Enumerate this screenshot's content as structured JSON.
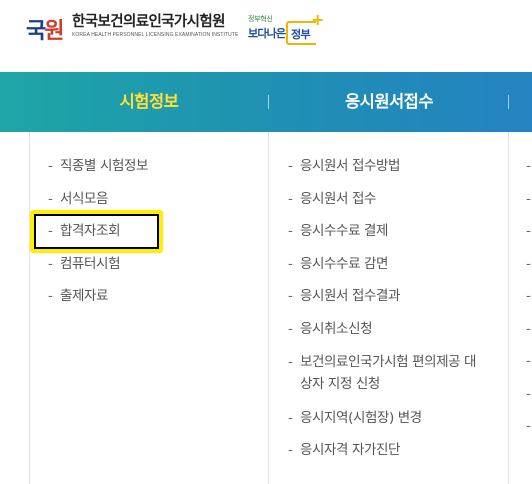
{
  "header": {
    "logo_mark_1": "국",
    "logo_mark_2": "원",
    "org_name_kor": "한국보건의료인국가시험원",
    "org_name_eng": "KOREA HEALTH PERSONNEL LICENSING EXAMINATION INSTITUTE",
    "gov_top": "정부혁신",
    "gov_main": "보다나은",
    "gov_badge": "정부"
  },
  "nav": {
    "items": [
      {
        "label": "시험정보",
        "active": true
      },
      {
        "label": "응시원서접수",
        "active": false
      }
    ]
  },
  "menu": {
    "col1": [
      "직종별 시험정보",
      "서식모음",
      "합격자조회",
      "컴퓨터시험",
      "출제자료"
    ],
    "col2": [
      "응시원서 접수방법",
      "응시원서 접수",
      "응시수수료 결제",
      "응시수수료 감면",
      "응시원서 접수결과",
      "응시취소신청",
      "보건의료인국가시험 편의제공 대상자 지정 신청",
      "응시지역(시험장) 변경",
      "응시자격 자가진단"
    ],
    "col3": [
      "",
      "",
      "",
      "",
      "",
      "",
      "",
      "",
      ""
    ]
  },
  "highlighted_item": "합격자조회",
  "colors": {
    "nav_gradient_start": "#1ea6a6",
    "nav_gradient_end": "#2483c1",
    "active_nav_text": "#ffe034",
    "highlight_border": "#ffee00"
  }
}
